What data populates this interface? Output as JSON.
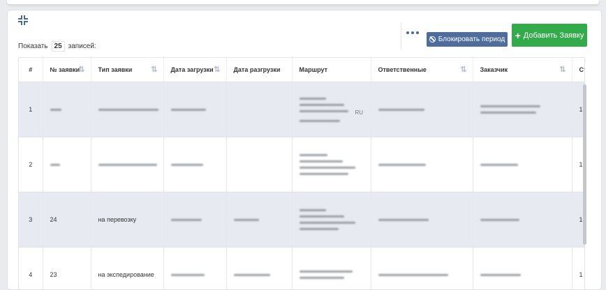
{
  "toolbar": {
    "show_prefix": "Показать",
    "page_length": "25",
    "show_suffix": "записей:",
    "block_period_label": "Блокировать период",
    "add_request_label": "Добавить Заявку"
  },
  "table": {
    "columns": [
      "#",
      "№ заявки",
      "Тип заявки",
      "Дата загрузки",
      "Дата разгрузки",
      "Маршрут",
      "Ответственные",
      "Заказчик",
      "Ст"
    ],
    "rows": [
      {
        "index": "1",
        "number": "",
        "type": "",
        "route_suffix": "RU",
        "last": "1"
      },
      {
        "index": "2",
        "number": "",
        "type": "",
        "route_suffix": "",
        "last": "1"
      },
      {
        "index": "3",
        "number": "24",
        "type": "на перевозку",
        "route_suffix": "",
        "last": "1"
      },
      {
        "index": "4",
        "number": "23",
        "type": "на экспедирование",
        "route_suffix": "",
        "last": "1"
      }
    ]
  },
  "colors": {
    "primary_button": "#4f6d9c",
    "success_button": "#33ab4a",
    "stripe": "#e7ebf1"
  }
}
